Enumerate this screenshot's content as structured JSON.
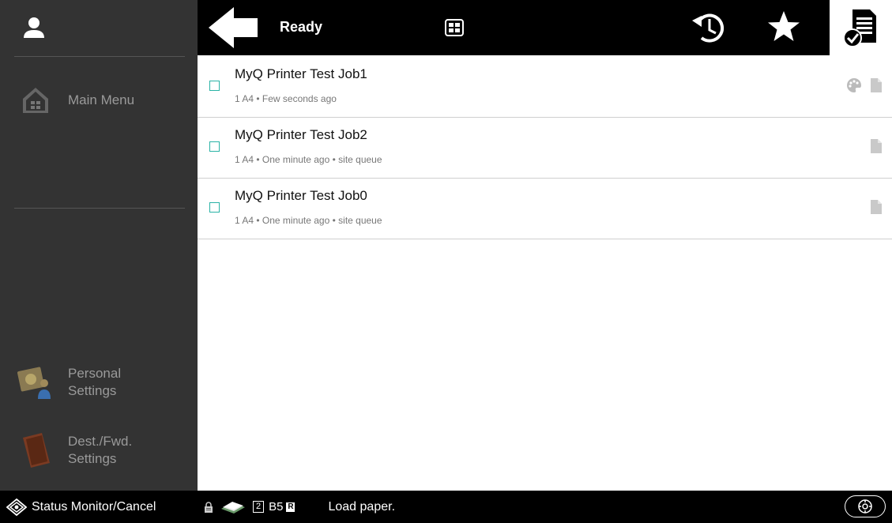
{
  "sidebar": {
    "items": [
      {
        "label": "Main Menu",
        "icon": "home-icon"
      },
      {
        "label": "Personal\nSettings",
        "icon": "personal-settings-icon"
      },
      {
        "label": "Dest./Fwd.\nSettings",
        "icon": "address-book-icon"
      }
    ]
  },
  "topbar": {
    "status": "Ready"
  },
  "jobs": [
    {
      "name": "MyQ Printer Test Job1",
      "meta": "1 A4 • Few seconds ago",
      "color": true
    },
    {
      "name": "MyQ Printer Test Job2",
      "meta": "1 A4 • One minute ago • site queue",
      "color": false
    },
    {
      "name": "MyQ Printer Test Job0",
      "meta": "1 A4 • One minute ago • site queue",
      "color": false
    }
  ],
  "statusbar": {
    "monitor_label": "Status Monitor/Cancel",
    "tray": "2",
    "paper_size": "B5",
    "paper_orientation": "R",
    "message": "Load paper."
  },
  "colors": {
    "sidebar_bg": "#333333",
    "topbar_bg": "#000000",
    "checkbox": "#2ab3a6"
  }
}
